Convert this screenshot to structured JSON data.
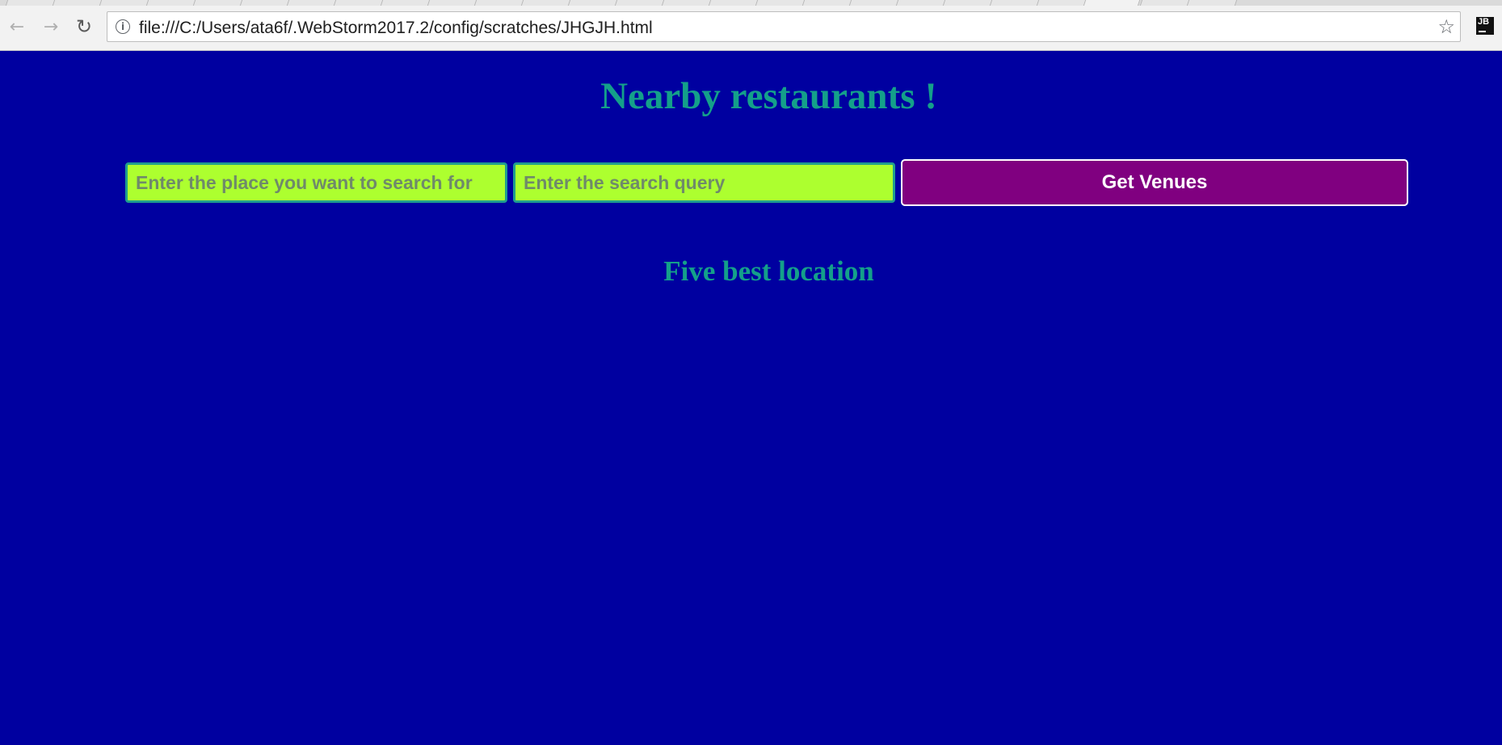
{
  "browser": {
    "url": "file:///C:/Users/ata6f/.WebStorm2017.2/config/scratches/JHGJH.html",
    "icons": {
      "back": "arrow-left-icon",
      "forward": "arrow-right-icon",
      "reload": "reload-icon",
      "info": "info-icon",
      "bookmark": "star-icon",
      "extension": "jetbrains-icon"
    },
    "extension_label": "JB"
  },
  "page": {
    "title": "Nearby restaurants !",
    "place_input": {
      "placeholder": "Enter the place you want to search for",
      "value": ""
    },
    "query_input": {
      "placeholder": "Enter the search query",
      "value": ""
    },
    "submit_label": "Get Venues",
    "results_heading": "Five best location",
    "results": []
  },
  "colors": {
    "background": "#0000a0",
    "heading": "#14a08a",
    "input_bg": "#adff2f",
    "button_bg": "#800080",
    "button_text": "#ffffff"
  }
}
